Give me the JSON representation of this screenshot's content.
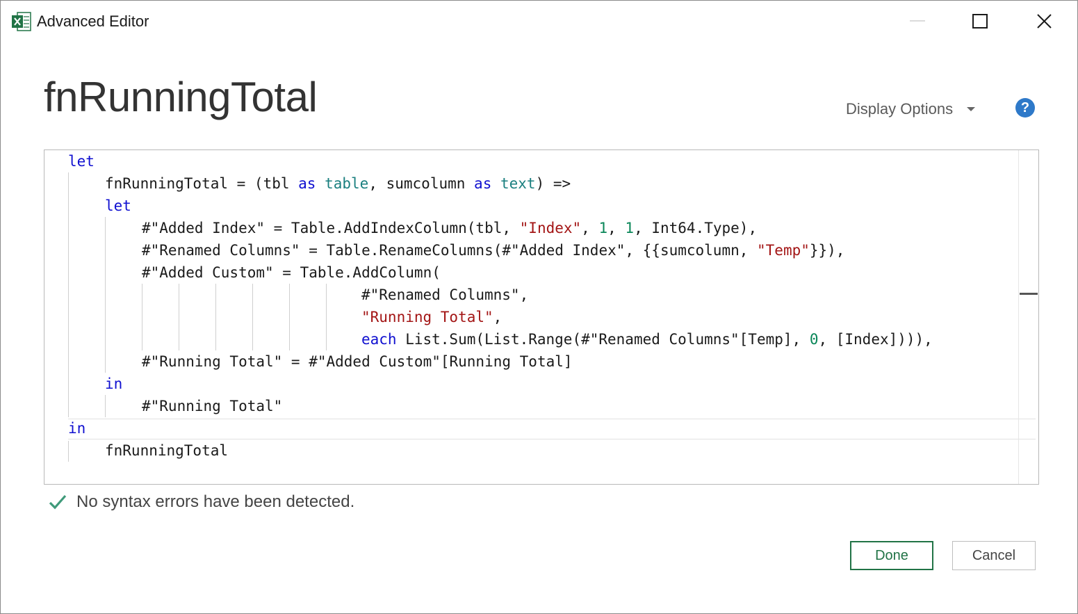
{
  "window": {
    "title": "Advanced Editor",
    "app_icon": "excel-icon",
    "controls": [
      "minimize-icon",
      "maximize-icon",
      "close-icon"
    ]
  },
  "query_name": "fnRunningTotal",
  "toolbar": {
    "display_options_label": "Display Options",
    "help_icon": "help-icon",
    "help_glyph": "?"
  },
  "editor": {
    "lines": [
      [
        {
          "t": "let",
          "c": "kw"
        }
      ],
      [
        {
          "t": "fnRunningTotal = (tbl "
        },
        {
          "t": "as",
          "c": "kw"
        },
        {
          "t": " "
        },
        {
          "t": "table",
          "c": "ty"
        },
        {
          "t": ", sumcolumn "
        },
        {
          "t": "as",
          "c": "kw"
        },
        {
          "t": " "
        },
        {
          "t": "text",
          "c": "ty"
        },
        {
          "t": ") =>"
        }
      ],
      [
        {
          "t": "let",
          "c": "kw"
        }
      ],
      [
        {
          "t": "#\"Added Index\" = Table.AddIndexColumn(tbl, "
        },
        {
          "t": "\"Index\"",
          "c": "st"
        },
        {
          "t": ", "
        },
        {
          "t": "1",
          "c": "nm"
        },
        {
          "t": ", "
        },
        {
          "t": "1",
          "c": "nm"
        },
        {
          "t": ", Int64.Type),"
        }
      ],
      [
        {
          "t": "#\"Renamed Columns\" = Table.RenameColumns(#\"Added Index\", {{sumcolumn, "
        },
        {
          "t": "\"Temp\"",
          "c": "st"
        },
        {
          "t": "}}),"
        }
      ],
      [
        {
          "t": "#\"Added Custom\" = Table.AddColumn("
        }
      ],
      [
        {
          "t": "#\"Renamed Columns\","
        }
      ],
      [
        {
          "t": "\"Running Total\"",
          "c": "st"
        },
        {
          "t": ","
        }
      ],
      [
        {
          "t": "each",
          "c": "kw"
        },
        {
          "t": " List.Sum(List.Range(#\"Renamed Columns\"[Temp], "
        },
        {
          "t": "0",
          "c": "nm"
        },
        {
          "t": ", [Index]))),"
        }
      ],
      [
        {
          "t": "#\"Running Total\" = #\"Added Custom\"[Running Total]"
        }
      ],
      [
        {
          "t": "in",
          "c": "kw"
        }
      ],
      [
        {
          "t": "#\"Running Total\""
        }
      ],
      [
        {
          "t": "in",
          "c": "kw"
        }
      ],
      [
        {
          "t": "fnRunningTotal"
        }
      ]
    ]
  },
  "status": {
    "icon": "checkmark-icon",
    "text": "No syntax errors have been detected."
  },
  "buttons": {
    "done_label": "Done",
    "cancel_label": "Cancel"
  }
}
